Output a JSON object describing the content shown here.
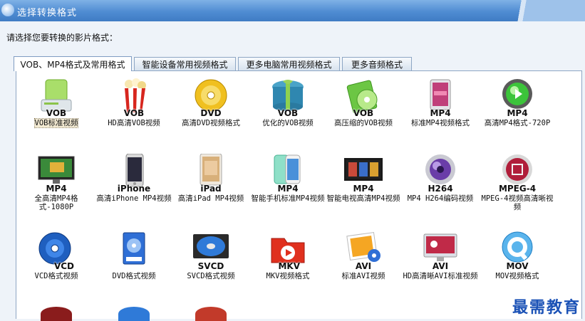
{
  "window": {
    "title": "选择转换格式"
  },
  "prompt": "请选择您要转换的影片格式：",
  "tabs": [
    {
      "label": "VOB、MP4格式及常用格式",
      "active": true
    },
    {
      "label": "智能设备常用视频格式"
    },
    {
      "label": "更多电脑常用视频格式"
    },
    {
      "label": "更多音频格式"
    }
  ],
  "formats": [
    {
      "badge": "VOB",
      "label": "VOB标准视频",
      "icon": "green-drive-icon",
      "selected": true
    },
    {
      "badge": "VOB",
      "label": "HD高清VOB视频",
      "icon": "popcorn-icon"
    },
    {
      "badge": "DVD",
      "label": "高清DVD视频格式",
      "icon": "gold-disc-icon"
    },
    {
      "badge": "VOB",
      "label": "优化的VOB视频",
      "icon": "gift-box-icon"
    },
    {
      "badge": "VOB",
      "label": "高压缩的VOB视频",
      "icon": "green-case-icon"
    },
    {
      "badge": "MP4",
      "label": "标准MP4视频格式",
      "icon": "tablet-icon"
    },
    {
      "badge": "MP4",
      "label": "高清MP4格式-720P",
      "icon": "green-orb-icon"
    },
    {
      "badge": "MP4",
      "label": "全高清MP4格式-1080P",
      "icon": "monitor-icon"
    },
    {
      "badge": "iPhone",
      "label": "高清iPhone MP4视频",
      "icon": "iphone-icon"
    },
    {
      "badge": "iPad",
      "label": "高清iPad MP4视频",
      "icon": "ipad-icon"
    },
    {
      "badge": "MP4",
      "label": "智能手机标准MP4视频",
      "icon": "smartphone-icon"
    },
    {
      "badge": "MP4",
      "label": "智能电视高清MP4视频",
      "icon": "smart-tv-icon"
    },
    {
      "badge": "H264",
      "label": "MP4 H264编码视频",
      "icon": "purple-orb-icon"
    },
    {
      "badge": "MPEG-4",
      "label": "MPEG-4视频高清晰视频",
      "icon": "film-orb-icon"
    },
    {
      "badge": "VCD",
      "label": "VCD格式视频",
      "icon": "blue-disc-icon"
    },
    {
      "badge": "",
      "label": "DVD格式视频",
      "icon": "dvd-case-icon"
    },
    {
      "badge": "SVCD",
      "label": "SVCD格式视频",
      "icon": "disc-case-icon"
    },
    {
      "badge": "MKV",
      "label": "MKV视频格式",
      "icon": "play-folder-icon"
    },
    {
      "badge": "AVI",
      "label": "标准AVI视频",
      "icon": "photos-icon"
    },
    {
      "badge": "AVI",
      "label": "HD高清晰AVI标准视频",
      "icon": "display-icon"
    },
    {
      "badge": "MOV",
      "label": "MOV视频格式",
      "icon": "quicktime-icon"
    }
  ],
  "watermark": "最需教育"
}
